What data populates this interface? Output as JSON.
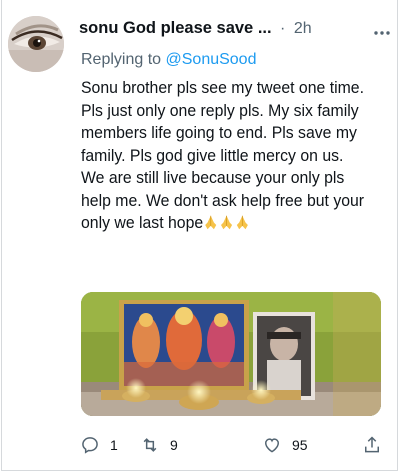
{
  "tweet": {
    "author_name": "sonu God please save ...",
    "separator": "·",
    "time": "2h",
    "reply_prefix": "Replying to",
    "reply_handle": "@SonuSood",
    "text": "Sonu brother pls see my tweet one time. Pls just only one reply pls. My six family members life going to end. Pls save my family. Pls god give little mercy on us. We are still live because your only pls help me. We don't ask help free but your only we last hope"
  },
  "actions": {
    "reply_count": "1",
    "retweet_count": "9",
    "like_count": "95"
  },
  "icons": {
    "more": "more-horizontal-icon",
    "reply": "comment-icon",
    "retweet": "retweet-icon",
    "like": "heart-icon",
    "share": "share-icon",
    "emoji": "folded-hands-emoji"
  },
  "colors": {
    "link": "#1d9bf0",
    "secondary_text": "#536471",
    "primary_text": "#0f1419"
  }
}
